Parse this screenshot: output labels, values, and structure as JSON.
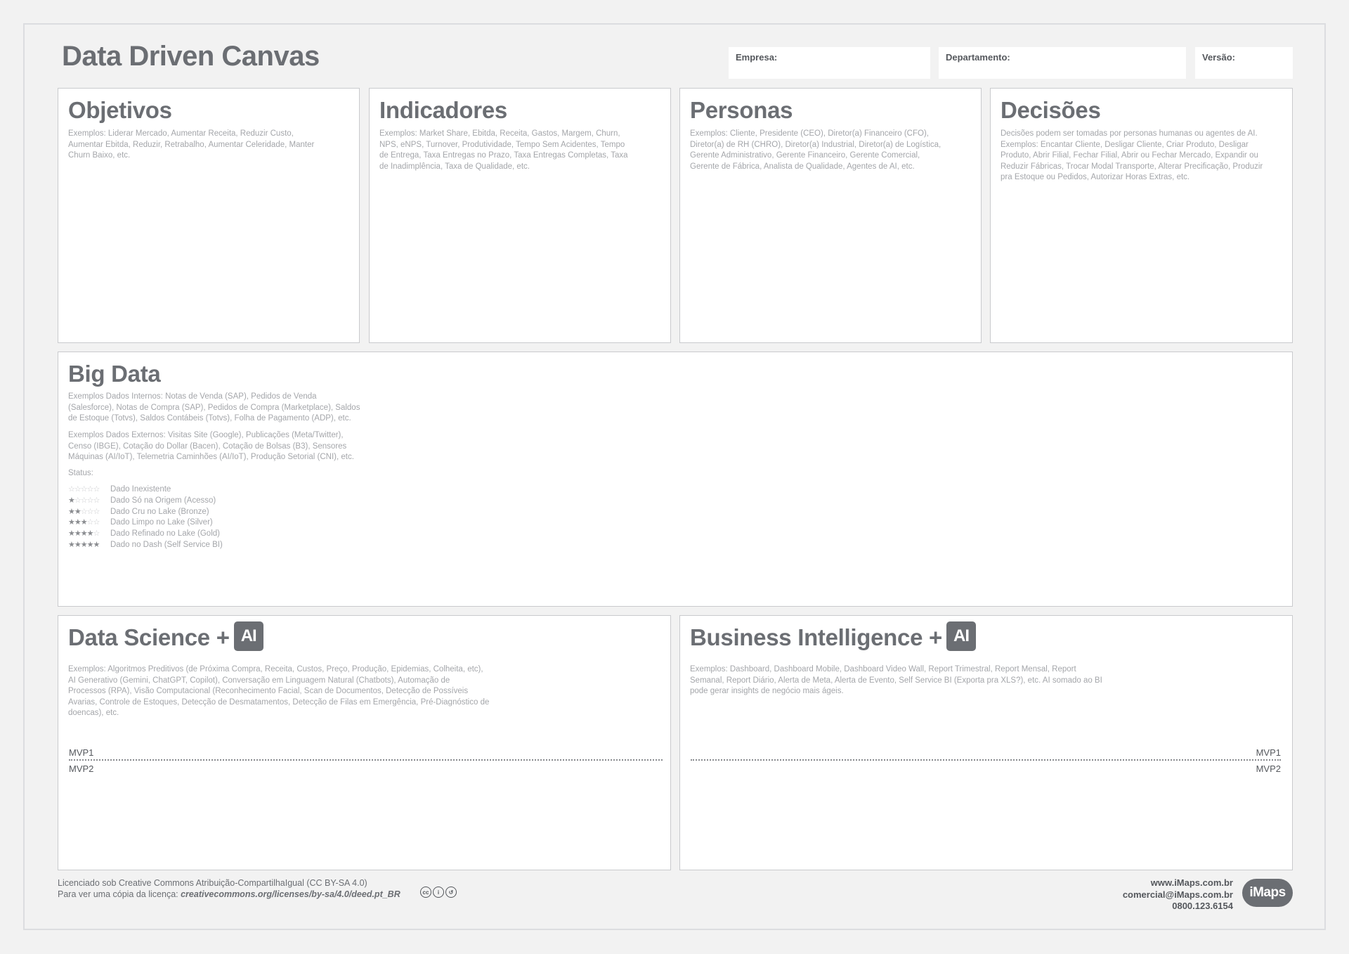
{
  "header": {
    "title": "Data Driven Canvas",
    "fields": {
      "empresa": "Empresa:",
      "departamento": "Departamento:",
      "versao": "Versão:"
    }
  },
  "objetivos": {
    "title": "Objetivos",
    "examples": "Exemplos: Liderar Mercado, Aumentar Receita, Reduzir Custo, Aumentar Ebitda, Reduzir, Retrabalho, Aumentar Celeridade, Manter Churn Baixo, etc."
  },
  "indicadores": {
    "title": "Indicadores",
    "examples": "Exemplos: Market Share, Ebitda, Receita, Gastos, Margem, Churn, NPS, eNPS, Turnover, Produtividade, Tempo Sem Acidentes, Tempo de Entrega, Taxa Entregas no Prazo, Taxa Entregas Completas, Taxa de Inadimplência, Taxa de Qualidade, etc."
  },
  "personas": {
    "title": "Personas",
    "examples": "Exemplos: Cliente, Presidente (CEO), Diretor(a) Financeiro (CFO), Diretor(a) de RH (CHRO), Diretor(a) Industrial, Diretor(a) de Logística, Gerente Administrativo, Gerente Financeiro, Gerente Comercial, Gerente de Fábrica, Analista de Qualidade, Agentes de AI, etc."
  },
  "decisoes": {
    "title": "Decisões",
    "examples": "Decisões podem ser tomadas por personas humanas ou agentes de AI. Exemplos: Encantar Cliente, Desligar Cliente, Criar Produto, Desligar Produto, Abrir Filial, Fechar Filial, Abrir ou Fechar Mercado, Expandir ou Reduzir Fábricas, Trocar Modal Transporte, Alterar Precificação, Produzir pra Estoque ou Pedidos, Autorizar Horas Extras, etc."
  },
  "big_data": {
    "title": "Big Data",
    "internal": "Exemplos Dados Internos: Notas de Venda (SAP), Pedidos de Venda (Salesforce), Notas de Compra (SAP), Pedidos de Compra (Marketplace), Saldos de Estoque (Totvs), Saldos Contábeis (Totvs), Folha de Pagamento (ADP), etc.",
    "external": "Exemplos Dados Externos: Visitas Site (Google), Publicações (Meta/Twitter), Censo (IBGE), Cotação do Dollar (Bacen), Cotação de Bolsas (B3), Sensores Máquinas (AI/IoT), Telemetria Caminhões (AI/IoT), Produção Setorial (CNI), etc.",
    "status_label": "Status:",
    "status": [
      {
        "stars": 0,
        "label": "Dado Inexistente"
      },
      {
        "stars": 1,
        "label": "Dado Só na Origem (Acesso)"
      },
      {
        "stars": 2,
        "label": "Dado Cru no Lake (Bronze)"
      },
      {
        "stars": 3,
        "label": "Dado Limpo no Lake (Silver)"
      },
      {
        "stars": 4,
        "label": "Dado Refinado no Lake (Gold)"
      },
      {
        "stars": 5,
        "label": "Dado no Dash (Self Service BI)"
      }
    ]
  },
  "data_science": {
    "title": "Data Science +",
    "badge": "AI",
    "examples": "Exemplos: Algoritmos Preditivos (de Próxima Compra, Receita, Custos, Preço, Produção, Epidemias, Colheita, etc), AI Generativo (Gemini, ChatGPT, Copilot), Conversação em Linguagem Natural (Chatbots), Automação de Processos (RPA), Visão Computacional (Reconhecimento Facial, Scan de Documentos, Detecção de Possíveis Avarias, Controle de Estoques, Detecção de Desmatamentos, Detecção de Filas em Emergência, Pré-Diagnóstico de doencas), etc.",
    "mvp1": "MVP1",
    "mvp2": "MVP2"
  },
  "business_intelligence": {
    "title": "Business Intelligence +",
    "badge": "AI",
    "examples": "Exemplos: Dashboard, Dashboard Mobile, Dashboard Video Wall, Report Trimestral, Report Mensal, Report Semanal, Report Diário, Alerta de Meta, Alerta de Evento, Self Service BI (Exporta pra XLS?), etc. AI somado ao BI pode gerar insights de negócio mais ágeis.",
    "mvp1": "MVP1",
    "mvp2": "MVP2"
  },
  "footer": {
    "license_line": "Licenciado sob Creative Commons Atribuição-CompartilhaIgual (CC BY-SA 4.0)",
    "copy_prefix": "Para ver uma cópia da licença:",
    "copy_url": "creativecommons.org/licenses/by-sa/4.0/deed.pt_BR",
    "website": "www.iMaps.com.br",
    "email": "comercial@iMaps.com.br",
    "phone": "0800.123.6154",
    "logo_text": "iMaps"
  },
  "icons": {
    "cc": "cc-icon",
    "by": "by-icon",
    "sa": "sa-icon",
    "ai_badge": "ai-sparkle-icon"
  },
  "colors": {
    "background": "#f2f2f2",
    "panel": "#ffffff",
    "title_text": "#6b6e73",
    "example_text": "#a4a6aa"
  }
}
